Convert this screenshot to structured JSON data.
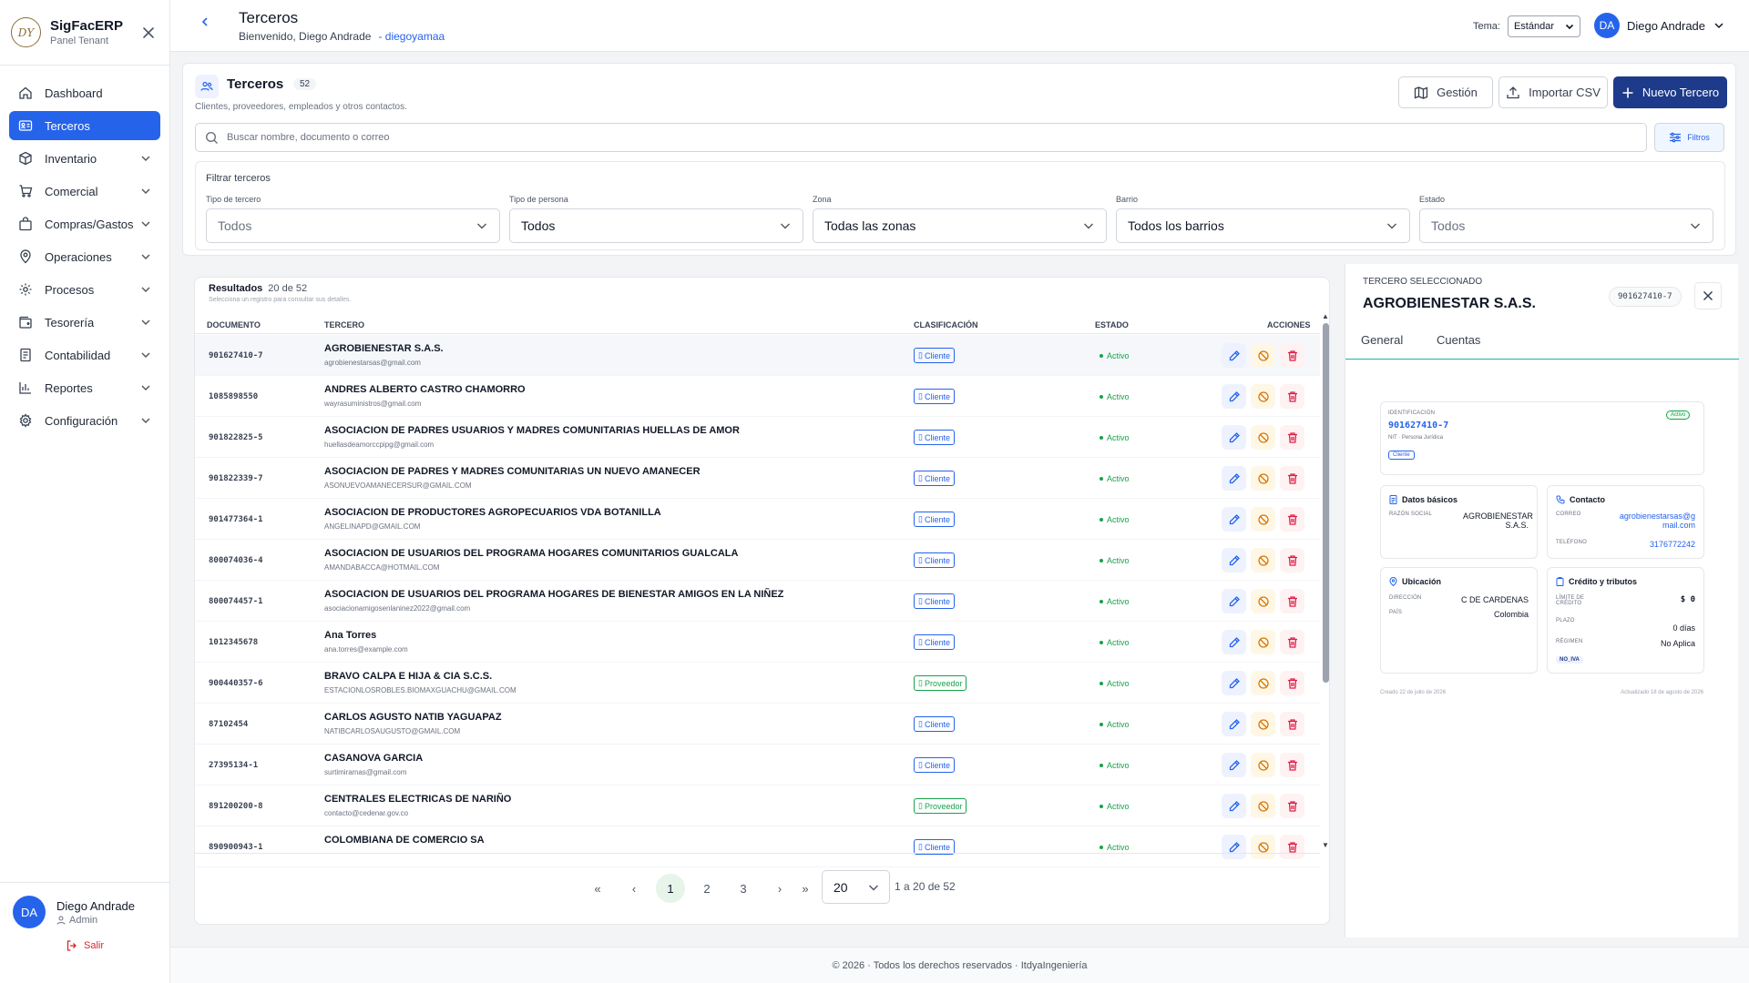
{
  "brand": {
    "logo_text": "DY",
    "name": "SigFacERP",
    "subtitle": "Panel Tenant"
  },
  "sidebar": {
    "items": [
      {
        "label": "Dashboard",
        "icon": "home-icon",
        "active": false,
        "expandable": false
      },
      {
        "label": "Terceros",
        "icon": "id-card-icon",
        "active": true,
        "expandable": false
      },
      {
        "label": "Inventario",
        "icon": "box-icon",
        "active": false,
        "expandable": true
      },
      {
        "label": "Comercial",
        "icon": "cart-icon",
        "active": false,
        "expandable": true
      },
      {
        "label": "Compras/Gastos",
        "icon": "shopping-bag-icon",
        "active": false,
        "expandable": true
      },
      {
        "label": "Operaciones",
        "icon": "map-pin-icon",
        "active": false,
        "expandable": true
      },
      {
        "label": "Procesos",
        "icon": "cog-icon",
        "active": false,
        "expandable": true
      },
      {
        "label": "Tesorería",
        "icon": "wallet-icon",
        "active": false,
        "expandable": true
      },
      {
        "label": "Contabilidad",
        "icon": "ledger-icon",
        "active": false,
        "expandable": true
      },
      {
        "label": "Reportes",
        "icon": "bar-chart-icon",
        "active": false,
        "expandable": true
      },
      {
        "label": "Configuración",
        "icon": "settings-icon",
        "active": false,
        "expandable": true
      }
    ],
    "user": {
      "initials": "DA",
      "name": "Diego Andrade",
      "role": "Admin",
      "logout": "Salir"
    }
  },
  "topbar": {
    "title": "Terceros",
    "welcome": "Bienvenido, Diego Andrade",
    "username": "- diegoyamaa",
    "theme_label": "Tema:",
    "theme_value": "Estándar",
    "user_initials": "DA",
    "user_name": "Diego Andrade"
  },
  "page": {
    "title": "Terceros",
    "count": "52",
    "description": "Clientes, proveedores, empleados y otros contactos.",
    "buttons": {
      "gestion": "Gestión",
      "import": "Importar CSV",
      "new": "Nuevo Tercero"
    },
    "search_placeholder": "Buscar nombre, documento o correo",
    "filters_button": "Filtros"
  },
  "filters": {
    "title": "Filtrar terceros",
    "fields": [
      {
        "label": "Tipo de tercero",
        "value": "Todos"
      },
      {
        "label": "Tipo de persona",
        "value": "Todos"
      },
      {
        "label": "Zona",
        "value": "Todas las zonas"
      },
      {
        "label": "Barrio",
        "value": "Todos los barrios"
      },
      {
        "label": "Estado",
        "value": "Todos"
      }
    ]
  },
  "results": {
    "title": "Resultados",
    "count": "20 de 52",
    "hint": "Selecciona un registro para consultar sus detalles.",
    "columns": [
      "DOCUMENTO",
      "TERCERO",
      "CLASIFICACIÓN",
      "ESTADO",
      "ACCIONES"
    ],
    "rows": [
      {
        "doc": "901627410-7",
        "name": "AGROBIENESTAR S.A.S.",
        "email": "agrobienestarsas@gmail.com",
        "class": "Cliente",
        "state": "Activo"
      },
      {
        "doc": "1085898550",
        "name": "ANDRES ALBERTO CASTRO CHAMORRO",
        "email": "wayrasuministros@gmail.com",
        "class": "Cliente",
        "state": "Activo"
      },
      {
        "doc": "901822825-5",
        "name": "ASOCIACION DE PADRES USUARIOS Y MADRES COMUNITARIAS HUELLAS DE AMOR",
        "email": "huellasdeamorccpipg@gmail.com",
        "class": "Cliente",
        "state": "Activo"
      },
      {
        "doc": "901822339-7",
        "name": "ASOCIACION DE PADRES Y MADRES COMUNITARIAS UN NUEVO AMANECER",
        "email": "ASONUEVOAMANECERSUR@GMAIL.COM",
        "class": "Cliente",
        "state": "Activo"
      },
      {
        "doc": "901477364-1",
        "name": "ASOCIACION DE PRODUCTORES AGROPECUARIOS VDA BOTANILLA",
        "email": "ANGELINAPD@GMAIL.COM",
        "class": "Cliente",
        "state": "Activo"
      },
      {
        "doc": "800074036-4",
        "name": "ASOCIACION DE USUARIOS DEL PROGRAMA HOGARES COMUNITARIOS GUALCALA",
        "email": "AMANDABACCA@HOTMAIL.COM",
        "class": "Cliente",
        "state": "Activo"
      },
      {
        "doc": "800074457-1",
        "name": "ASOCIACION DE USUARIOS DEL PROGRAMA HOGARES DE BIENESTAR AMIGOS EN LA NIÑEZ",
        "email": "asociacionamigosenlaninez2022@gmail.com",
        "class": "Cliente",
        "state": "Activo"
      },
      {
        "doc": "1012345678",
        "name": "Ana Torres",
        "email": "ana.torres@example.com",
        "class": "Cliente",
        "state": "Activo"
      },
      {
        "doc": "900440357-6",
        "name": "BRAVO CALPA E HIJA & CIA S.C.S.",
        "email": "ESTACIONLOSROBLES.BIOMAXGUACHU@GMAIL.COM",
        "class": "Proveedor",
        "state": "Activo"
      },
      {
        "doc": "87102454",
        "name": "CARLOS AGUSTO NATIB YAGUAPAZ",
        "email": "NATIBCARLOSAUGUSTO@GMAIL.COM",
        "class": "Cliente",
        "state": "Activo"
      },
      {
        "doc": "27395134-1",
        "name": "CASANOVA GARCIA",
        "email": "surtimiramas@gmail.com",
        "class": "Cliente",
        "state": "Activo"
      },
      {
        "doc": "891200200-8",
        "name": "CENTRALES ELECTRICAS DE NARIÑO",
        "email": "contacto@cedenar.gov.co",
        "class": "Proveedor",
        "state": "Activo"
      },
      {
        "doc": "890900943-1",
        "name": "COLOMBIANA DE COMERCIO SA",
        "email": "",
        "class": "Cliente",
        "state": "Activo"
      }
    ]
  },
  "pagination": {
    "first": "«",
    "prev": "‹",
    "pages": [
      "1",
      "2",
      "3"
    ],
    "current": "1",
    "next": "›",
    "last": "»",
    "page_size": "20",
    "info": "1 a 20 de 52"
  },
  "detail": {
    "overline": "TERCERO SELECCIONADO",
    "name": "AGROBIENESTAR S.A.S.",
    "doc": "901627410-7",
    "tabs": [
      "General",
      "Cuentas"
    ],
    "id_card": {
      "label": "IDENTIFICACIÓN",
      "value": "901627410-7",
      "type": "NIT · Persona Jurídica",
      "chip": "Cliente",
      "status": "Activo"
    },
    "basic": {
      "title": "Datos básicos",
      "key": "RAZÓN SOCIAL",
      "value": "AGROBIENESTAR S.A.S."
    },
    "contact": {
      "title": "Contacto",
      "email_key": "CORREO",
      "email": "agrobienestarsas@gmail.com",
      "phone_key": "TELÉFONO",
      "phone": "3176772242"
    },
    "location": {
      "title": "Ubicación",
      "addr_key": "DIRECCIÓN",
      "addr": "C DE CARDENAS",
      "country_key": "PAÍS",
      "country": "Colombia"
    },
    "credit": {
      "title": "Crédito y tributos",
      "limit_key": "LÍMITE DE CRÉDITO",
      "limit": "$ 0",
      "term_key": "PLAZO",
      "term": "0 días",
      "regime_key": "RÉGIMEN",
      "regime": "No Aplica",
      "chip": "NO_IVA"
    },
    "created": "Creado 22 de julio de 2026",
    "updated": "Actualizado 18 de agosto de 2026"
  },
  "footer": {
    "text": "© 2026 · Todos los derechos reservados · ItdyaIngeniería"
  },
  "colors": {
    "primary": "#2563eb",
    "primary_dark": "#1e3a8a",
    "success": "#16a34a",
    "warning": "#d97706",
    "danger": "#e11d48"
  }
}
